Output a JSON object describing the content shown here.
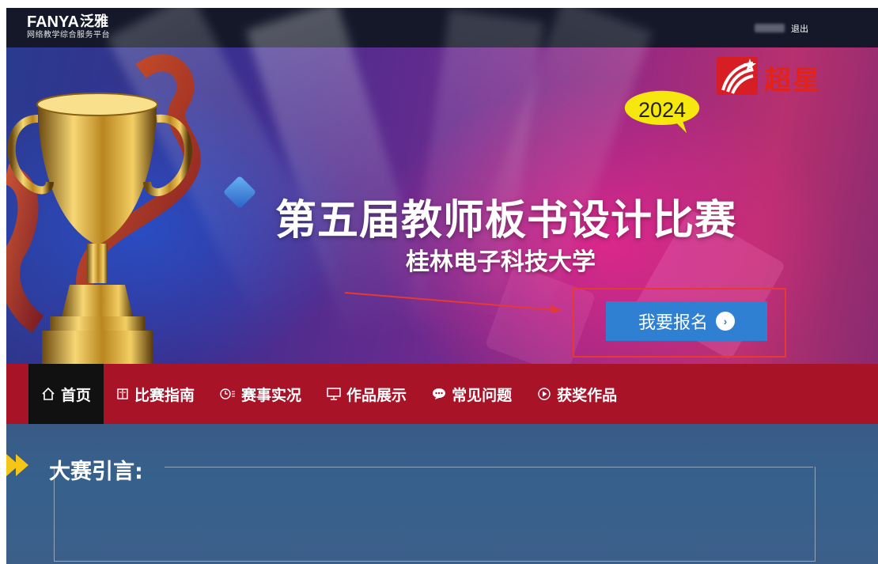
{
  "header": {
    "brand_main": "FANYA",
    "brand_cn": "泛雅",
    "brand_sub": "网络教学综合服务平台",
    "logout_label": "退出"
  },
  "banner": {
    "publisher_logo_text": "超星",
    "year": "2024",
    "title": "第五届教师板书设计比赛",
    "subtitle": "桂林电子科技大学",
    "signup_label": "我要报名",
    "signup_icon": "chevron-right-circle-icon"
  },
  "nav": {
    "items": [
      {
        "label": "首页",
        "icon": "home-icon",
        "active": true
      },
      {
        "label": "比赛指南",
        "icon": "book-icon"
      },
      {
        "label": "赛事实况",
        "icon": "clock-list-icon"
      },
      {
        "label": "作品展示",
        "icon": "monitor-icon"
      },
      {
        "label": "常见问题",
        "icon": "chat-bubble-icon"
      },
      {
        "label": "获奖作品",
        "icon": "play-circle-icon"
      }
    ]
  },
  "section": {
    "title": "大赛引言:"
  },
  "colors": {
    "topbar": "#141829",
    "nav": "#a81328",
    "nav_active": "#111111",
    "signup_button": "#2f7fd3",
    "highlight_box": "#e53935",
    "section_arrow": "#f5c518"
  }
}
